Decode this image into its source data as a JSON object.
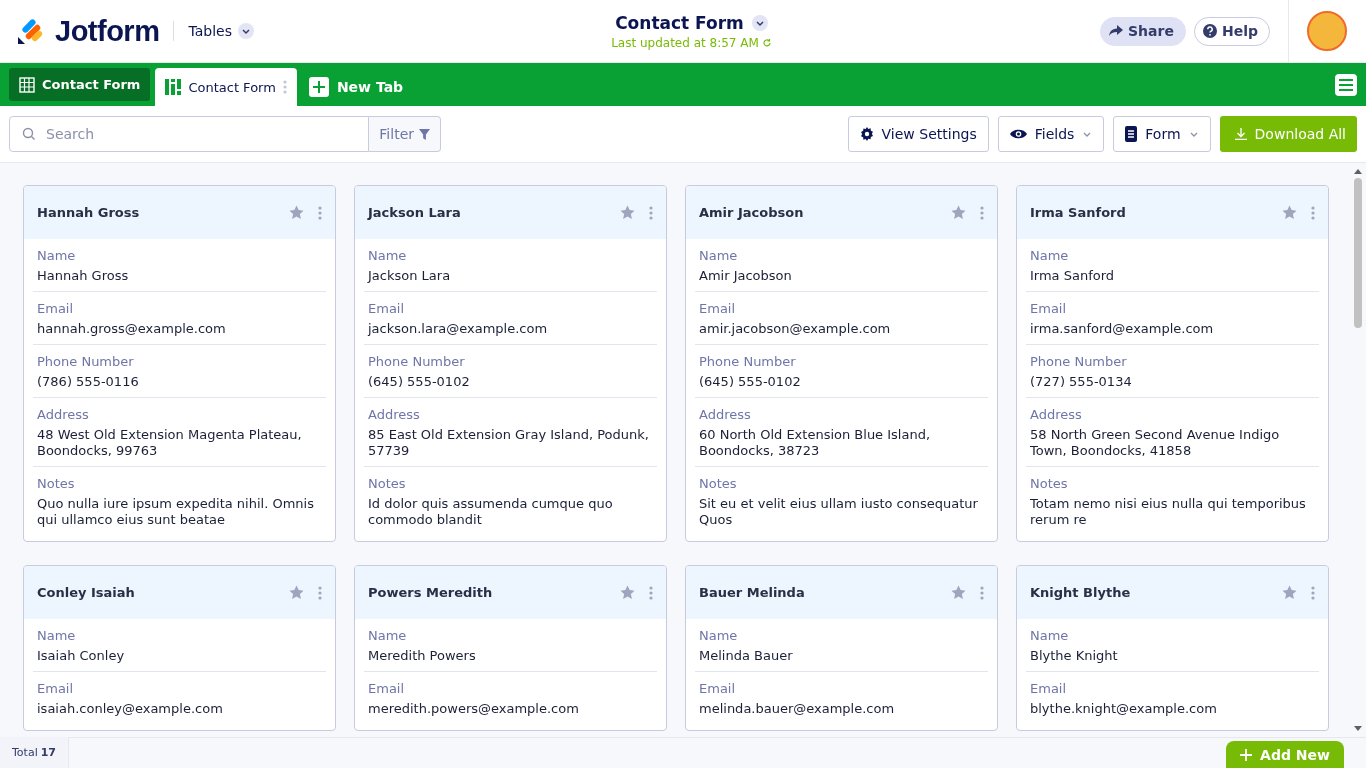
{
  "header": {
    "logo": "Jotform",
    "app_menu": "Tables",
    "title": "Contact Form",
    "last_updated": "Last updated at 8:57 AM",
    "actions": [
      "Share",
      "Help"
    ]
  },
  "tabs": [
    {
      "label": "Contact Form",
      "kind": "table",
      "selected": false
    },
    {
      "label": "Contact Form",
      "kind": "cards",
      "selected": true
    }
  ],
  "new_tab": "New Tab",
  "toolbar": {
    "search": {
      "placeholder": "Search"
    },
    "filter": "Filter",
    "buttons": [
      {
        "label": "View Settings",
        "kind": "settings"
      },
      {
        "label": "Fields",
        "kind": "fields"
      },
      {
        "label": "Form",
        "kind": "form"
      }
    ],
    "download": "Download All"
  },
  "cards": [
    {
      "title": "Hannah Gross",
      "fields": [
        {
          "label": "Name",
          "value": "Hannah Gross"
        },
        {
          "label": "Email",
          "value": "hannah.gross@example.com"
        },
        {
          "label": "Phone Number",
          "value": "(786) 555-0116"
        },
        {
          "label": "Address",
          "value": "48 West Old Extension  Magenta Plateau, Boondocks, 99763"
        },
        {
          "label": "Notes",
          "value": "Quo nulla iure ipsum expedita nihil. Omnis qui ullamco eius sunt beatae"
        }
      ]
    },
    {
      "title": "Jackson Lara",
      "fields": [
        {
          "label": "Name",
          "value": "Jackson Lara"
        },
        {
          "label": "Email",
          "value": "jackson.lara@example.com"
        },
        {
          "label": "Phone Number",
          "value": "(645) 555-0102"
        },
        {
          "label": "Address",
          "value": "85 East Old Extension  Gray Island, Podunk, 57739"
        },
        {
          "label": "Notes",
          "value": "Id dolor quis assumenda cumque quo commodo blandit"
        }
      ]
    },
    {
      "title": "Amir Jacobson",
      "fields": [
        {
          "label": "Name",
          "value": "Amir Jacobson"
        },
        {
          "label": "Email",
          "value": "amir.jacobson@example.com"
        },
        {
          "label": "Phone Number",
          "value": "(645) 555-0102"
        },
        {
          "label": "Address",
          "value": "60 North Old Extension  Blue Island, Boondocks, 38723"
        },
        {
          "label": "Notes",
          "value": "Sit eu et velit eius ullam iusto consequatur Quos"
        }
      ]
    },
    {
      "title": "Irma Sanford",
      "fields": [
        {
          "label": "Name",
          "value": "Irma Sanford"
        },
        {
          "label": "Email",
          "value": "irma.sanford@example.com"
        },
        {
          "label": "Phone Number",
          "value": "(727) 555-0134"
        },
        {
          "label": "Address",
          "value": "58 North Green Second Avenue  Indigo Town, Boondocks, 41858"
        },
        {
          "label": "Notes",
          "value": "Totam nemo nisi eius nulla qui temporibus rerum re"
        }
      ]
    },
    {
      "title": "Conley Isaiah",
      "fields": [
        {
          "label": "Name",
          "value": "Isaiah Conley"
        },
        {
          "label": "Email",
          "value": "isaiah.conley@example.com"
        }
      ]
    },
    {
      "title": "Powers Meredith",
      "fields": [
        {
          "label": "Name",
          "value": "Meredith Powers"
        },
        {
          "label": "Email",
          "value": "meredith.powers@example.com"
        }
      ]
    },
    {
      "title": "Bauer Melinda",
      "fields": [
        {
          "label": "Name",
          "value": "Melinda Bauer"
        },
        {
          "label": "Email",
          "value": "melinda.bauer@example.com"
        }
      ]
    },
    {
      "title": "Knight Blythe",
      "fields": [
        {
          "label": "Name",
          "value": "Blythe Knight"
        },
        {
          "label": "Email",
          "value": "blythe.knight@example.com"
        }
      ]
    }
  ],
  "footer": {
    "total_label": "Total",
    "total": "17",
    "add_new": "Add New"
  }
}
